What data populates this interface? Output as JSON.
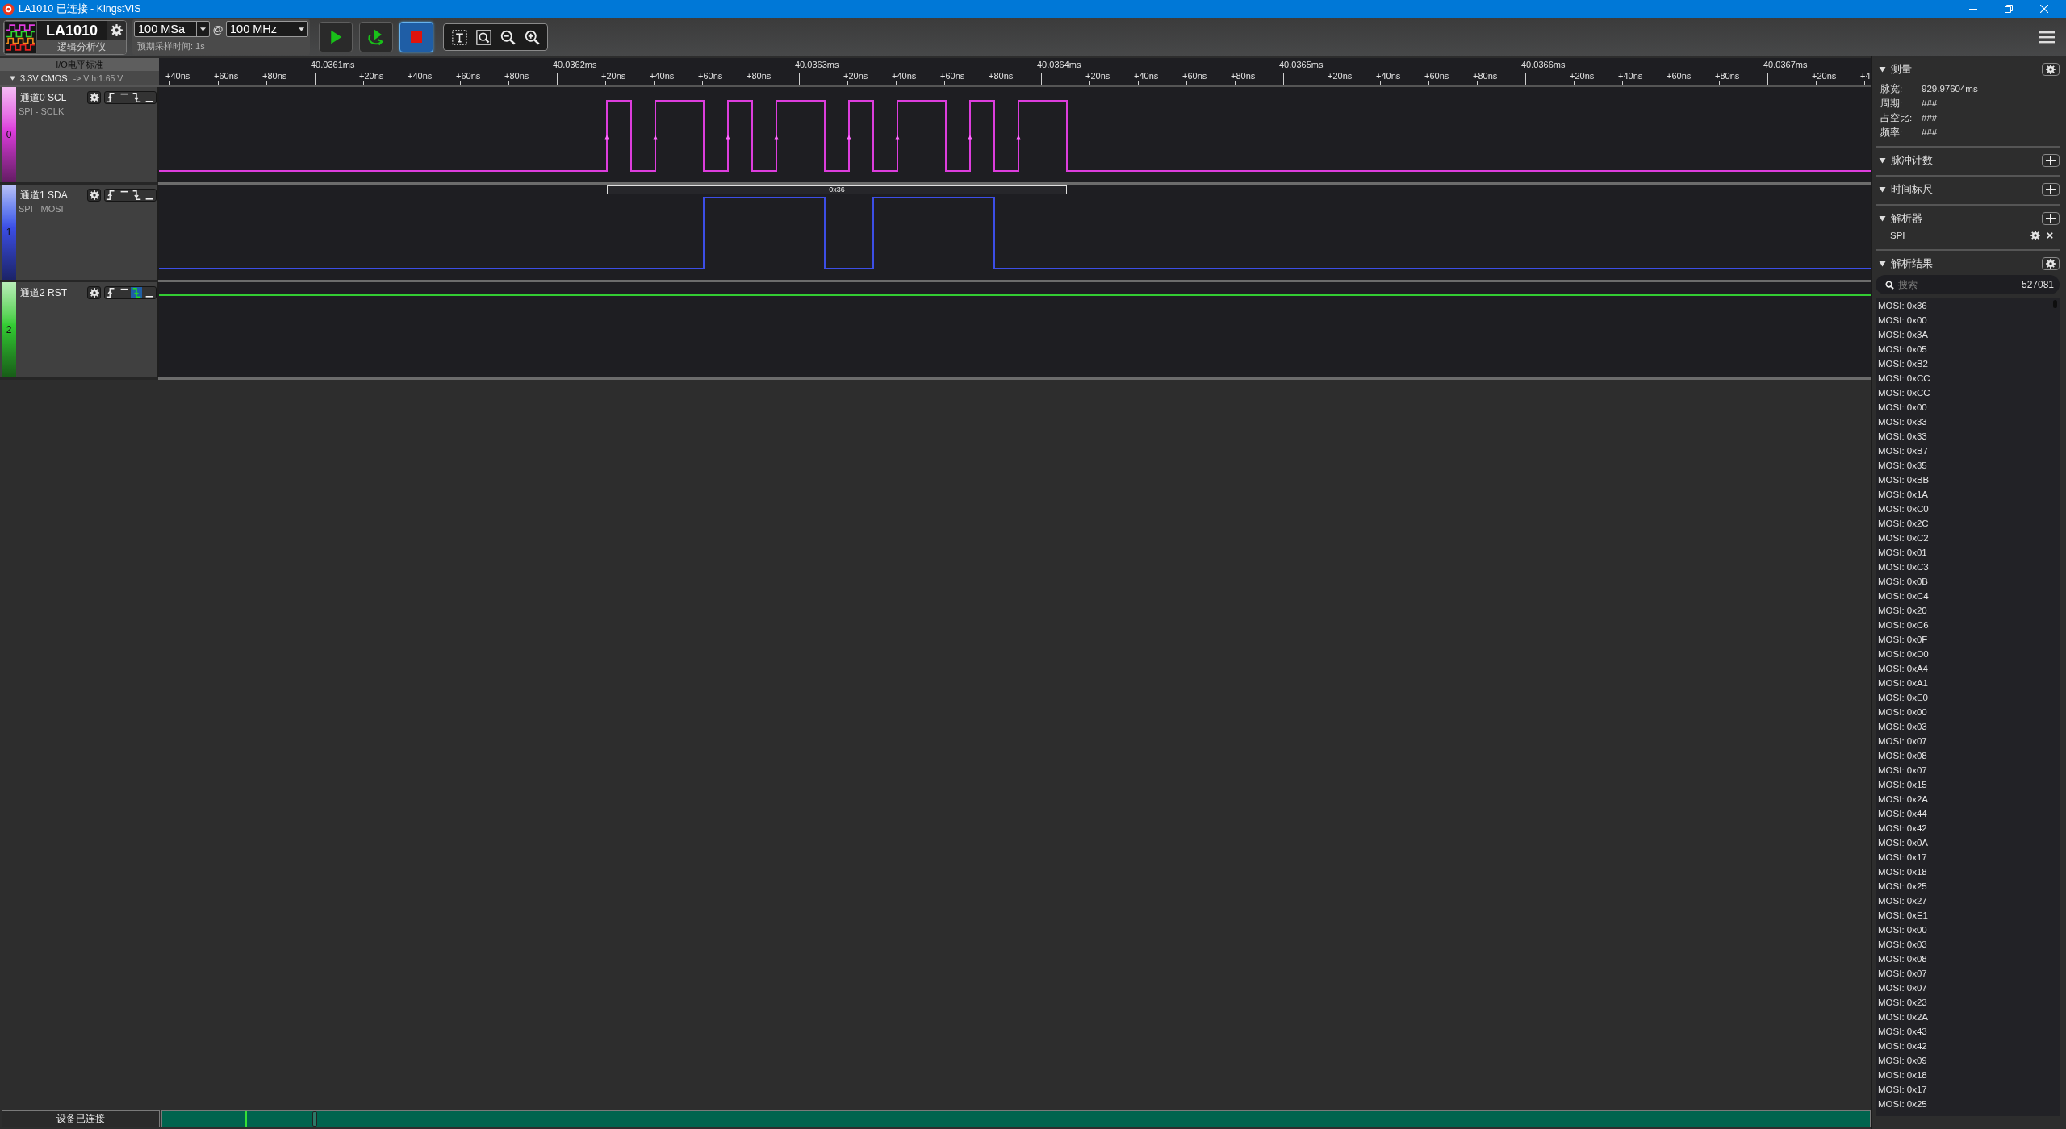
{
  "window": {
    "title": "LA1010 已连接 - KingstVIS"
  },
  "toolbar": {
    "device": {
      "name": "LA1010",
      "type": "逻辑分析仪"
    },
    "sample_depth": {
      "value": "100 MSa"
    },
    "at_sign": "@",
    "sample_rate": {
      "value": "100 MHz"
    },
    "sample_time": "预期采样时间: 1s",
    "run_buttons": [
      {
        "kind": "start",
        "active": false
      },
      {
        "kind": "loop",
        "active": false
      },
      {
        "kind": "stop",
        "active": true
      }
    ]
  },
  "io_standard": {
    "title": "I/O电平标准",
    "value": "3.3V CMOS",
    "threshold": "-> Vth:1.65 V"
  },
  "ruler": {
    "ticks": [
      {
        "label": "+40ns",
        "kind": "minor"
      },
      {
        "label": "+60ns",
        "kind": "minor"
      },
      {
        "label": "+80ns",
        "kind": "minor"
      },
      {
        "label": "40.0361ms",
        "kind": "major"
      },
      {
        "label": "+20ns",
        "kind": "minor"
      },
      {
        "label": "+40ns",
        "kind": "minor"
      },
      {
        "label": "+60ns",
        "kind": "minor"
      },
      {
        "label": "+80ns",
        "kind": "minor"
      },
      {
        "label": "40.0362ms",
        "kind": "major"
      },
      {
        "label": "+20ns",
        "kind": "minor"
      },
      {
        "label": "+40ns",
        "kind": "minor"
      },
      {
        "label": "+60ns",
        "kind": "minor"
      },
      {
        "label": "+80ns",
        "kind": "minor"
      },
      {
        "label": "40.0363ms",
        "kind": "major"
      },
      {
        "label": "+20ns",
        "kind": "minor"
      },
      {
        "label": "+40ns",
        "kind": "minor"
      },
      {
        "label": "+60ns",
        "kind": "minor"
      },
      {
        "label": "+80ns",
        "kind": "minor"
      },
      {
        "label": "40.0364ms",
        "kind": "major"
      },
      {
        "label": "+20ns",
        "kind": "minor"
      },
      {
        "label": "+40ns",
        "kind": "minor"
      },
      {
        "label": "+60ns",
        "kind": "minor"
      },
      {
        "label": "+80ns",
        "kind": "minor"
      },
      {
        "label": "40.0365ms",
        "kind": "major"
      },
      {
        "label": "+20ns",
        "kind": "minor"
      },
      {
        "label": "+40ns",
        "kind": "minor"
      },
      {
        "label": "+60ns",
        "kind": "minor"
      },
      {
        "label": "+80ns",
        "kind": "minor"
      },
      {
        "label": "40.0366ms",
        "kind": "major"
      },
      {
        "label": "+20ns",
        "kind": "minor"
      },
      {
        "label": "+40ns",
        "kind": "minor"
      },
      {
        "label": "+60ns",
        "kind": "minor"
      },
      {
        "label": "+80ns",
        "kind": "minor"
      },
      {
        "label": "40.0367ms",
        "kind": "major"
      },
      {
        "label": "+20ns",
        "kind": "minor"
      },
      {
        "label": "+4",
        "kind": "minor"
      }
    ]
  },
  "channels": [
    {
      "number": "0",
      "name": "通道0 SCL",
      "protocol": "SPI - SCLK",
      "color": "#dd3ddd",
      "triggers": [
        {
          "kind": "rising",
          "selected": false
        },
        {
          "kind": "high",
          "selected": false
        },
        {
          "kind": "falling",
          "selected": false
        },
        {
          "kind": "low",
          "selected": false
        }
      ]
    },
    {
      "number": "1",
      "name": "通道1 SDA",
      "protocol": "SPI - MOSI",
      "color": "#3c4ee6",
      "triggers": [
        {
          "kind": "rising",
          "selected": false
        },
        {
          "kind": "high",
          "selected": false
        },
        {
          "kind": "falling",
          "selected": false
        },
        {
          "kind": "low",
          "selected": false
        }
      ],
      "decodes": [
        {
          "text": "0x36"
        }
      ]
    },
    {
      "number": "2",
      "name": "通道2 RST",
      "color": "#33cc33",
      "triggers": [
        {
          "kind": "rising",
          "selected": false
        },
        {
          "kind": "high",
          "selected": false
        },
        {
          "kind": "falling",
          "selected": true
        },
        {
          "kind": "low",
          "selected": false
        }
      ]
    }
  ],
  "status_bar": {
    "text": "设备已连接"
  },
  "side_panel": {
    "sections": [
      {
        "kind": "measurements",
        "title": "测量",
        "expanded": true,
        "button": {
          "kind": "settings"
        },
        "rows": [
          {
            "label": "脉宽:",
            "value": "929.97604ms"
          },
          {
            "label": "周期:",
            "value": "###"
          },
          {
            "label": "占空比:",
            "value": "###"
          },
          {
            "label": "频率:",
            "value": "###"
          }
        ]
      },
      {
        "kind": "plain",
        "title": "脉冲计数",
        "expanded": true,
        "button": {
          "kind": "add"
        }
      },
      {
        "kind": "plain",
        "title": "时间标尺",
        "expanded": true,
        "button": {
          "kind": "add"
        }
      },
      {
        "kind": "decoders",
        "title": "解析器",
        "expanded": true,
        "button": {
          "kind": "add"
        },
        "items": [
          {
            "name": "SPI"
          }
        ]
      },
      {
        "kind": "results",
        "title": "解析结果",
        "expanded": true,
        "button": {
          "kind": "settings"
        },
        "search": {
          "placeholder": "搜索",
          "count": "527081"
        },
        "results": [
          "MOSI: 0x36",
          "MOSI: 0x00",
          "MOSI: 0x3A",
          "MOSI: 0x05",
          "MOSI: 0xB2",
          "MOSI: 0xCC",
          "MOSI: 0xCC",
          "MOSI: 0x00",
          "MOSI: 0x33",
          "MOSI: 0x33",
          "MOSI: 0xB7",
          "MOSI: 0x35",
          "MOSI: 0xBB",
          "MOSI: 0x1A",
          "MOSI: 0xC0",
          "MOSI: 0x2C",
          "MOSI: 0xC2",
          "MOSI: 0x01",
          "MOSI: 0xC3",
          "MOSI: 0x0B",
          "MOSI: 0xC4",
          "MOSI: 0x20",
          "MOSI: 0xC6",
          "MOSI: 0x0F",
          "MOSI: 0xD0",
          "MOSI: 0xA4",
          "MOSI: 0xA1",
          "MOSI: 0xE0",
          "MOSI: 0x00",
          "MOSI: 0x03",
          "MOSI: 0x07",
          "MOSI: 0x08",
          "MOSI: 0x07",
          "MOSI: 0x15",
          "MOSI: 0x2A",
          "MOSI: 0x44",
          "MOSI: 0x42",
          "MOSI: 0x0A",
          "MOSI: 0x17",
          "MOSI: 0x18",
          "MOSI: 0x25",
          "MOSI: 0x27",
          "MOSI: 0xE1",
          "MOSI: 0x00",
          "MOSI: 0x03",
          "MOSI: 0x08",
          "MOSI: 0x07",
          "MOSI: 0x07",
          "MOSI: 0x23",
          "MOSI: 0x2A",
          "MOSI: 0x43",
          "MOSI: 0x42",
          "MOSI: 0x09",
          "MOSI: 0x18",
          "MOSI: 0x17",
          "MOSI: 0x25"
        ]
      }
    ]
  }
}
